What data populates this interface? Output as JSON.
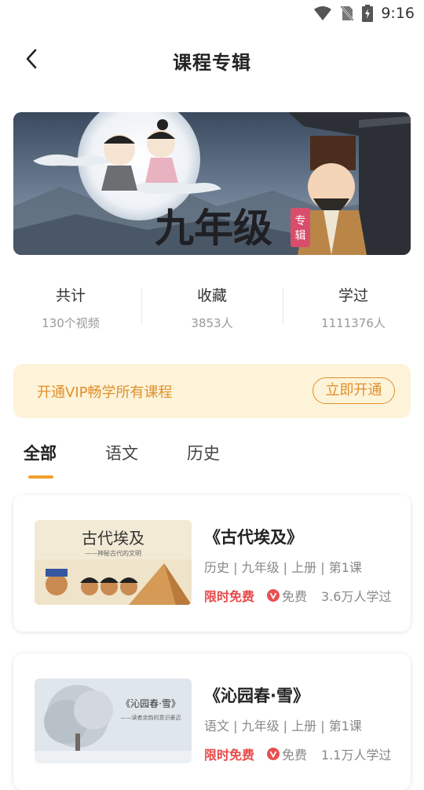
{
  "status_bar": {
    "time": "9:16"
  },
  "header": {
    "title": "课程专辑"
  },
  "banner": {
    "title": "九年级",
    "tag": "专辑"
  },
  "stats": [
    {
      "label": "共计",
      "value": "130个视频"
    },
    {
      "label": "收藏",
      "value": "3853人"
    },
    {
      "label": "学过",
      "value": "1111376人"
    }
  ],
  "vip": {
    "text": "开通VIP畅学所有课程",
    "button": "立即开通"
  },
  "tabs": [
    {
      "label": "全部",
      "active": true
    },
    {
      "label": "语文",
      "active": false
    },
    {
      "label": "历史",
      "active": false
    }
  ],
  "courses": [
    {
      "title": "《古代埃及》",
      "meta": "历史 | 九年级 | 上册 | 第1课",
      "promo": "限时免费",
      "free": "免费",
      "learners": "3.6万人学过",
      "thumb_title": "古代埃及",
      "thumb_sub": "——神秘古代的文明"
    },
    {
      "title": "《沁园春·雪》",
      "meta": "语文 | 九年级 | 上册 | 第1课",
      "promo": "限时免费",
      "free": "免费",
      "learners": "1.1万人学过",
      "thumb_title": "《沁园春·雪》",
      "thumb_sub": "——读者余韵的意识豪迈"
    }
  ],
  "colors": {
    "accent": "#f0a030",
    "vip_text": "#e0902c",
    "vip_bg": "#fdf3d9",
    "promo_red": "#e84a4a"
  }
}
